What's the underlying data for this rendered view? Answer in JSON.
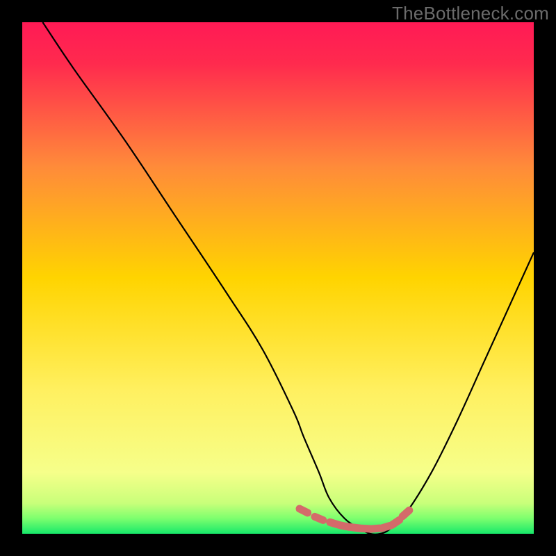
{
  "watermark": "TheBottleneck.com",
  "colors": {
    "bg": "#000000",
    "gradient_top": "#ff1a55",
    "gradient_mid": "#ffd400",
    "gradient_low": "#f6ff8a",
    "gradient_bottom": "#17e86a",
    "curve": "#000000",
    "marker": "#d46a6a"
  },
  "chart_data": {
    "type": "line",
    "title": "",
    "xlabel": "",
    "ylabel": "",
    "xlim": [
      0,
      100
    ],
    "ylim": [
      0,
      100
    ],
    "x": [
      4,
      10,
      20,
      30,
      40,
      47,
      53,
      55,
      58,
      60,
      63,
      66,
      68,
      70,
      72,
      75,
      80,
      85,
      90,
      95,
      100
    ],
    "values": [
      100,
      91,
      77,
      62,
      47,
      36,
      24,
      19,
      12,
      7,
      3,
      1,
      0,
      0,
      1,
      4,
      12,
      22,
      33,
      44,
      55
    ],
    "markers_x": [
      55,
      58,
      61,
      63,
      65,
      67,
      69,
      71,
      73,
      75
    ],
    "markers_y": [
      4.5,
      3.0,
      2.0,
      1.5,
      1.2,
      1.0,
      1.0,
      1.3,
      2.2,
      4.0
    ]
  }
}
